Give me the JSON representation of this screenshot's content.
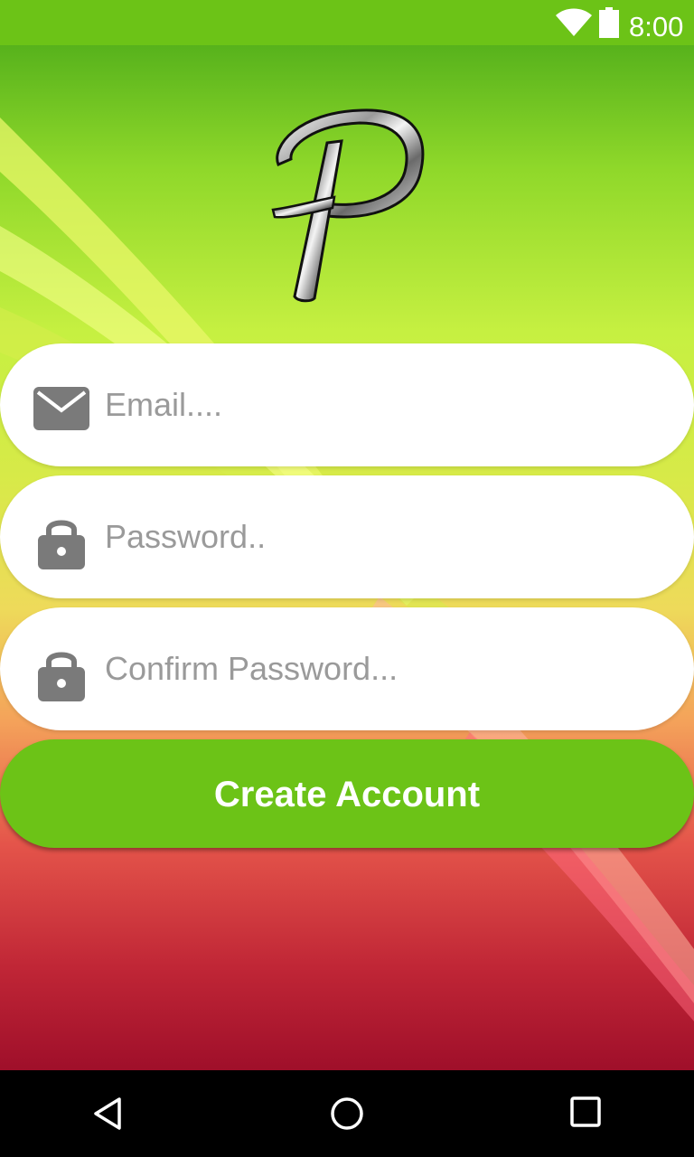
{
  "status_bar": {
    "time": "8:00",
    "wifi_icon": "wifi-icon",
    "battery_icon": "battery-icon",
    "background_color": "#6cc317"
  },
  "logo": {
    "icon": "script-letter-p-logo"
  },
  "form": {
    "email": {
      "icon": "envelope-icon",
      "placeholder": "Email....",
      "value": ""
    },
    "password": {
      "icon": "padlock-icon",
      "placeholder": "Password..",
      "value": ""
    },
    "confirm_password": {
      "icon": "padlock-icon",
      "placeholder": "Confirm Password...",
      "value": ""
    },
    "create_account_label": "Create Account"
  },
  "nav_bar": {
    "back_icon": "back-triangle-icon",
    "home_icon": "home-circle-icon",
    "recents_icon": "recents-square-icon"
  },
  "colors": {
    "accent": "#6cc317",
    "pill": "#ffffff",
    "placeholder": "#9a9a9a",
    "icon_gray": "#7a7a7a"
  }
}
